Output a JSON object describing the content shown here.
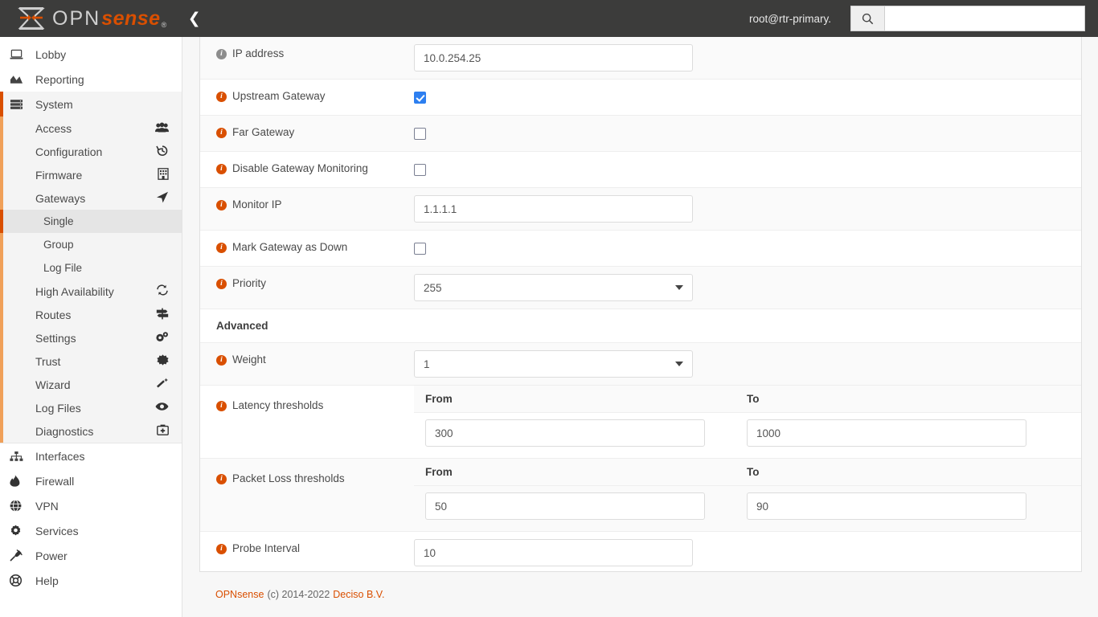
{
  "header": {
    "logo_opn": "OPN",
    "logo_sense": "sense",
    "logo_reg": "®",
    "collapse_icon": "chevron-left-icon",
    "user": "root@rtr-primary.",
    "search_icon": "search-icon",
    "search_value": "",
    "search_placeholder": ""
  },
  "sidebar": {
    "top_items": [
      {
        "label": "Lobby",
        "icon": "laptop-icon"
      },
      {
        "label": "Reporting",
        "icon": "chart-area-icon"
      }
    ],
    "system": {
      "label": "System",
      "icon": "server-icon"
    },
    "system_children": [
      {
        "label": "Access",
        "icon": "users-icon"
      },
      {
        "label": "Configuration",
        "icon": "history-icon"
      },
      {
        "label": "Firmware",
        "icon": "building-icon"
      },
      {
        "label": "Gateways",
        "icon": "location-arrow-icon"
      }
    ],
    "gateway_children": [
      {
        "label": "Single",
        "active": true
      },
      {
        "label": "Group",
        "active": false
      },
      {
        "label": "Log File",
        "active": false
      }
    ],
    "system_children_after": [
      {
        "label": "High Availability",
        "icon": "sync-icon"
      },
      {
        "label": "Routes",
        "icon": "signs-icon"
      },
      {
        "label": "Settings",
        "icon": "cogs-icon"
      },
      {
        "label": "Trust",
        "icon": "certificate-icon"
      },
      {
        "label": "Wizard",
        "icon": "magic-wand-icon"
      },
      {
        "label": "Log Files",
        "icon": "eye-icon"
      },
      {
        "label": "Diagnostics",
        "icon": "medkit-icon"
      }
    ],
    "bottom_items": [
      {
        "label": "Interfaces",
        "icon": "sitemap-icon"
      },
      {
        "label": "Firewall",
        "icon": "fire-icon"
      },
      {
        "label": "VPN",
        "icon": "globe-icon"
      },
      {
        "label": "Services",
        "icon": "cog-icon"
      },
      {
        "label": "Power",
        "icon": "plug-icon"
      },
      {
        "label": "Help",
        "icon": "lifering-icon"
      }
    ]
  },
  "form": {
    "rows": [
      {
        "label": "IP address",
        "type": "text",
        "value": "10.0.254.25",
        "info": "gray"
      },
      {
        "label": "Upstream Gateway",
        "type": "checkbox",
        "checked": true
      },
      {
        "label": "Far Gateway",
        "type": "checkbox",
        "checked": false
      },
      {
        "label": "Disable Gateway Monitoring",
        "type": "checkbox",
        "checked": false
      },
      {
        "label": "Monitor IP",
        "type": "text",
        "value": "1.1.1.1"
      },
      {
        "label": "Mark Gateway as Down",
        "type": "checkbox",
        "checked": false
      },
      {
        "label": "Priority",
        "type": "select",
        "value": "255"
      }
    ],
    "advanced_heading": "Advanced",
    "weight": {
      "label": "Weight",
      "type": "select",
      "value": "1"
    },
    "thresholds": [
      {
        "label": "Latency thresholds",
        "from_header": "From",
        "to_header": "To",
        "from_value": "300",
        "to_value": "1000"
      },
      {
        "label": "Packet Loss thresholds",
        "from_header": "From",
        "to_header": "To",
        "from_value": "50",
        "to_value": "90"
      }
    ],
    "probe_interval": {
      "label": "Probe Interval",
      "value": "10"
    }
  },
  "footer": {
    "brand": "OPNsense",
    "copyright": "(c) 2014-2022",
    "company": "Deciso B.V."
  },
  "colors": {
    "brand_orange": "#d94f00",
    "topbar": "#3c3c3b",
    "checkbox_checked": "#2d7ff0"
  }
}
